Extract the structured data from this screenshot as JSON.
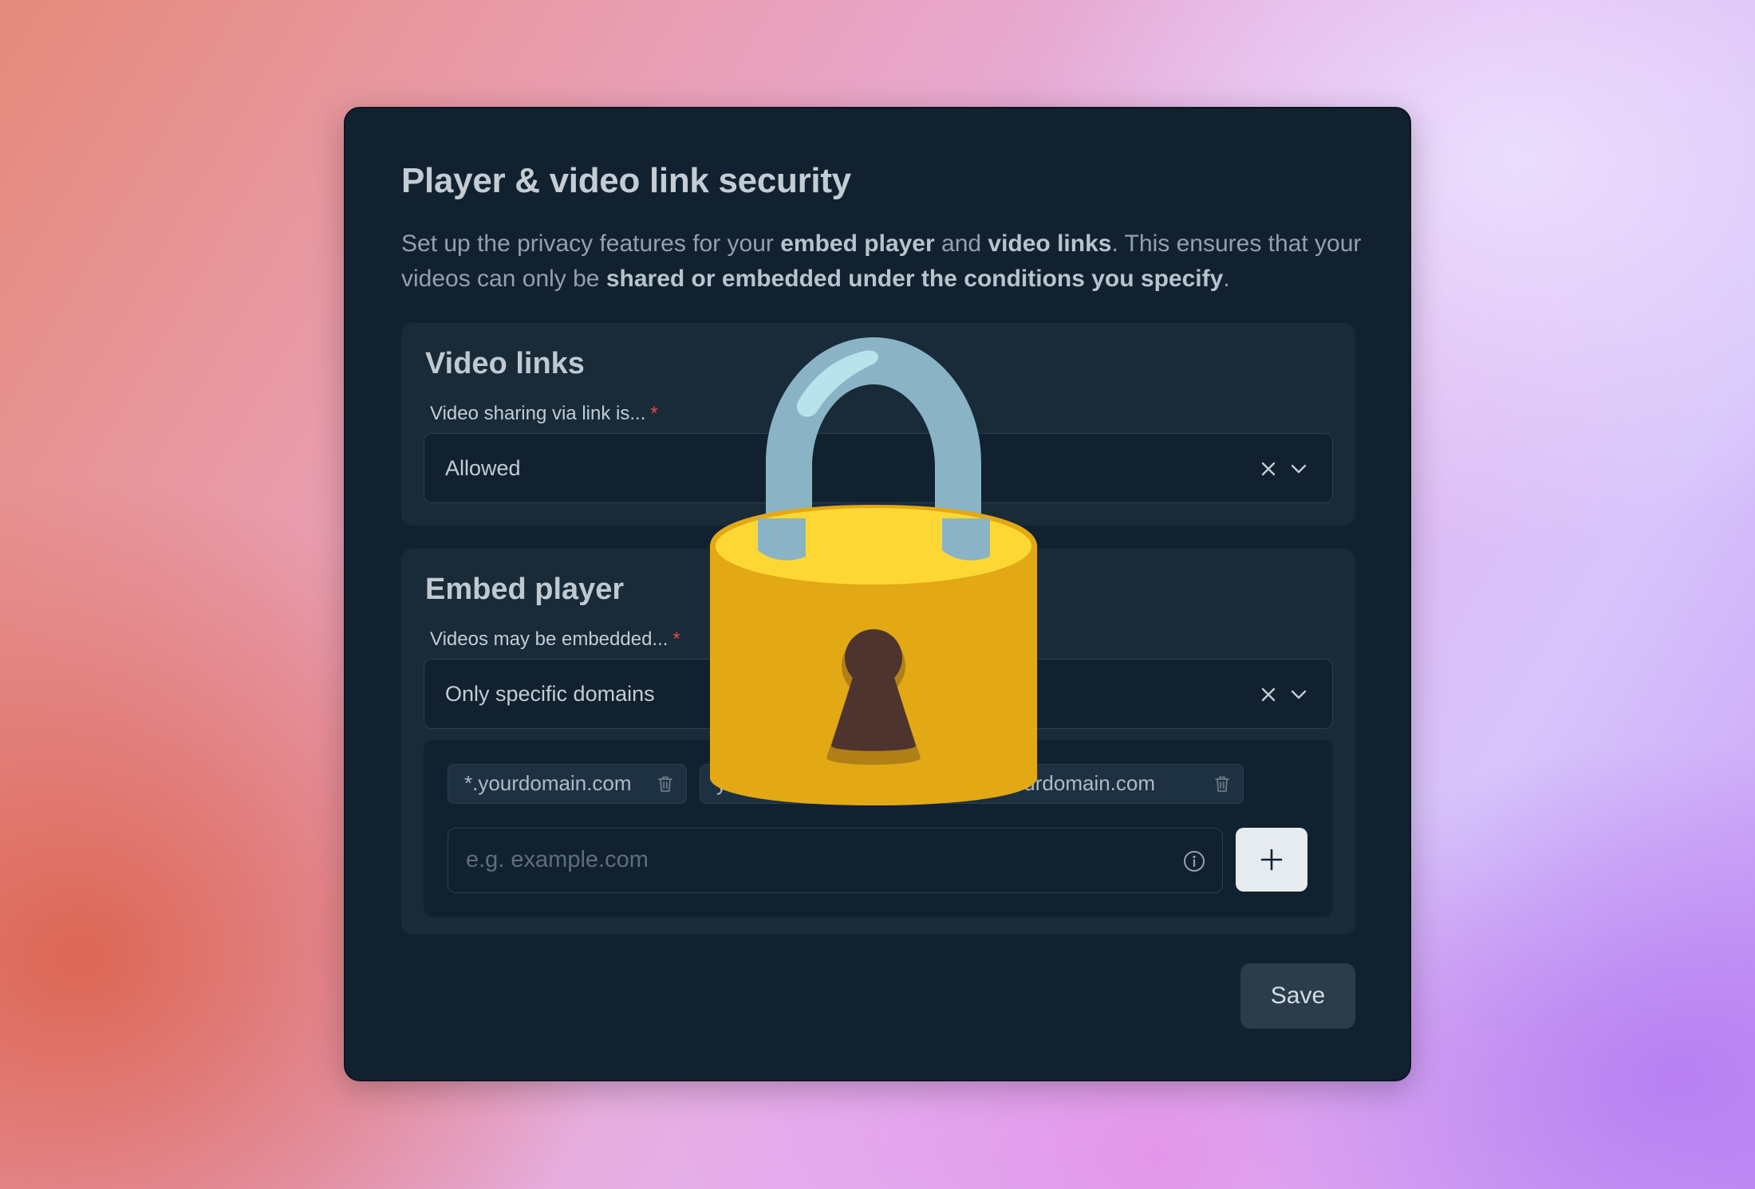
{
  "card": {
    "title": "Player & video link security",
    "description": {
      "p1": "Set up the privacy features for your ",
      "b1": "embed player",
      "p2": " and ",
      "b2": "video links",
      "p3": ". This ensures that your videos can only be ",
      "b3": "shared or embedded under the conditions you specify",
      "p4": "."
    }
  },
  "video_links": {
    "title": "Video links",
    "field_label": "Video sharing via link is...",
    "required_mark": "*",
    "value": "Allowed"
  },
  "embed_player": {
    "title": "Embed player",
    "field_label": "Videos may be embedded...",
    "required_mark": "*",
    "value": "Only specific domains",
    "domains": [
      "*.yourdomain.com",
      "your",
      "anet.yourdomain.com"
    ],
    "domain_input_placeholder": "e.g. example.com",
    "add_label": "+"
  },
  "actions": {
    "save_label": "Save"
  },
  "colors": {
    "card_bg": "#11212f",
    "section_bg": "#192a38",
    "required": "#e5484d",
    "add_button_bg": "#e6ebef",
    "save_button_bg": "#2b3d4b",
    "lock_body": "#e2a914",
    "lock_shackle": "#8ab4c6"
  },
  "icons": [
    "clear-icon",
    "chevron-down-icon",
    "trash-icon",
    "info-icon",
    "plus-icon",
    "padlock-icon"
  ]
}
